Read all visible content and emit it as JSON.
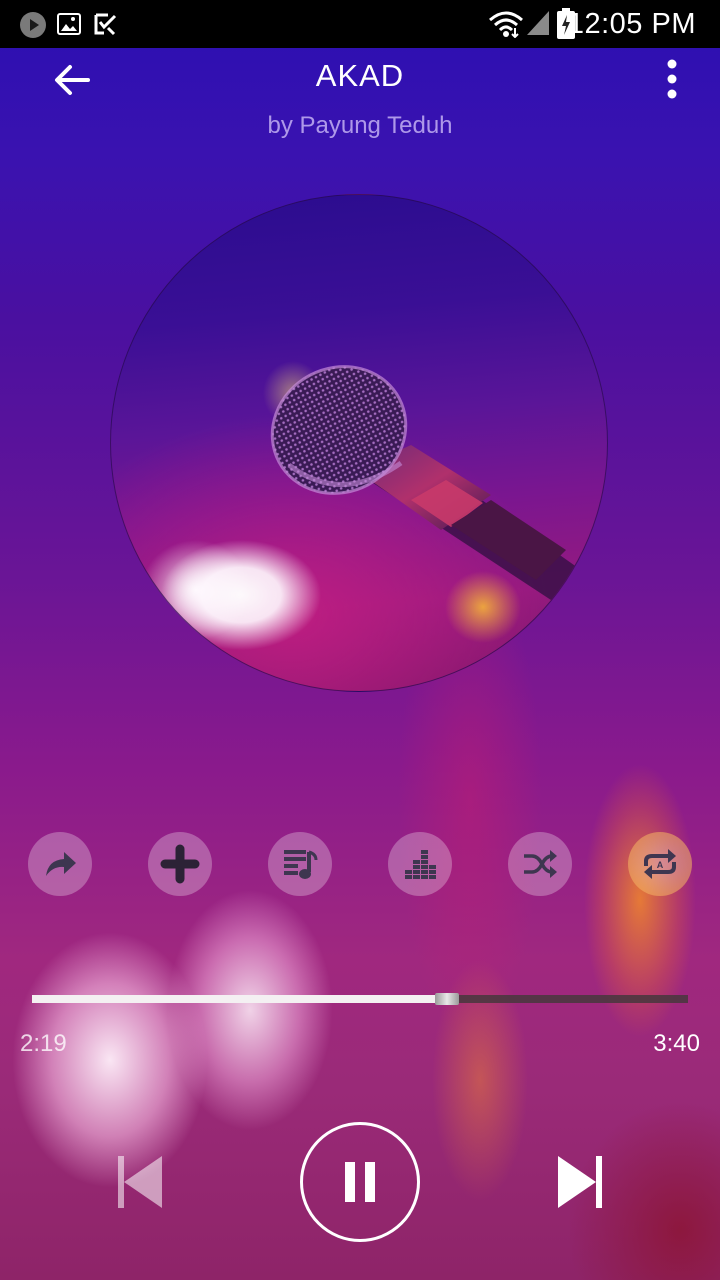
{
  "status_bar": {
    "time": "12:05 PM",
    "icons": [
      "play-circle-icon",
      "image-icon",
      "checklist-icon",
      "wifi-icon",
      "signal-icon",
      "battery-charging-icon"
    ]
  },
  "header": {
    "title": "AKAD",
    "artist": "by Payung Teduh",
    "icons": [
      "back-arrow-icon",
      "more-vert-icon"
    ]
  },
  "album_art": {
    "icon": "microphone-artwork"
  },
  "actions": [
    {
      "name": "share",
      "icon": "share-icon"
    },
    {
      "name": "add",
      "icon": "plus-icon"
    },
    {
      "name": "lyrics",
      "icon": "lyrics-icon"
    },
    {
      "name": "equalizer",
      "icon": "equalizer-icon"
    },
    {
      "name": "shuffle",
      "icon": "shuffle-icon"
    },
    {
      "name": "repeat",
      "icon": "repeat-icon",
      "color": "#f0a040"
    }
  ],
  "progress": {
    "elapsed": "2:19",
    "total": "3:40",
    "fraction": 0.632
  },
  "controls": {
    "icons": [
      "skip-previous-icon",
      "pause-icon",
      "skip-next-icon"
    ]
  },
  "colors": {
    "accent": "#ffffff",
    "background_top": "#2a0fb2",
    "background_bottom": "#8e2468"
  }
}
